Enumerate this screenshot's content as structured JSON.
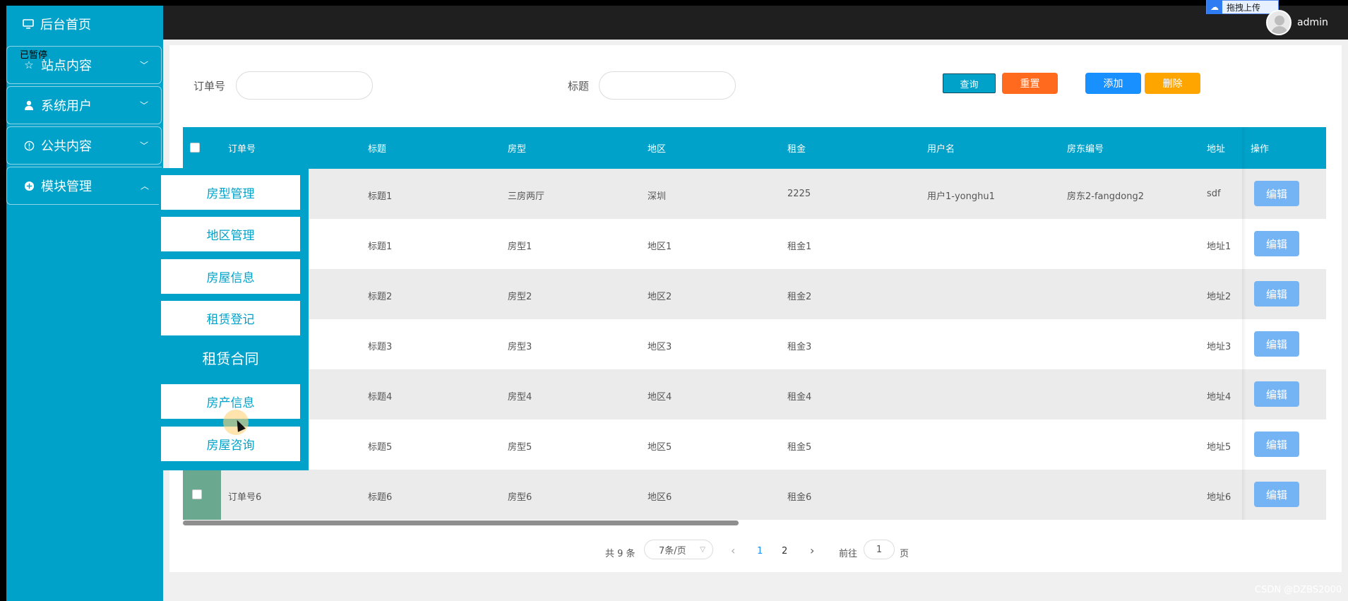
{
  "colors": {
    "primary": "#00a2c9",
    "reset": "#ff6a1e",
    "add": "#1890ff",
    "delete": "#ffa500",
    "edit": "#74b4f5"
  },
  "sidebar": {
    "home": {
      "label": "后台首页",
      "icon": "monitor-icon"
    },
    "paused_label": "已暂停",
    "items": [
      {
        "label": "站点内容",
        "icon": "star-icon"
      },
      {
        "label": "系统用户",
        "icon": "user-icon"
      },
      {
        "label": "公共内容",
        "icon": "info-circle-icon"
      },
      {
        "label": "模块管理",
        "icon": "plus-circle-icon"
      }
    ]
  },
  "topbar": {
    "username": "admin",
    "upload_label": "拖拽上传"
  },
  "search": {
    "order_label": "订单号",
    "title_label": "标题",
    "query_label": "查询",
    "reset_label": "重置",
    "add_label": "添加",
    "delete_label": "删除"
  },
  "table": {
    "headers": [
      "订单号",
      "标题",
      "房型",
      "地区",
      "租金",
      "用户名",
      "房东编号",
      "地址",
      "操作"
    ],
    "rows": [
      {
        "order": "",
        "title": "标题1",
        "type": "三房两厅",
        "region": "深圳",
        "rent": "2225",
        "user": "用户1-yonghu1",
        "landlord": "房东2-fangdong2",
        "address": "sdf"
      },
      {
        "order": "",
        "title": "标题1",
        "type": "房型1",
        "region": "地区1",
        "rent": "租金1",
        "user": "",
        "landlord": "",
        "address": "地址1"
      },
      {
        "order": "",
        "title": "标题2",
        "type": "房型2",
        "region": "地区2",
        "rent": "租金2",
        "user": "",
        "landlord": "",
        "address": "地址2"
      },
      {
        "order": "",
        "title": "标题3",
        "type": "房型3",
        "region": "地区3",
        "rent": "租金3",
        "user": "",
        "landlord": "",
        "address": "地址3"
      },
      {
        "order": "",
        "title": "标题4",
        "type": "房型4",
        "region": "地区4",
        "rent": "租金4",
        "user": "",
        "landlord": "",
        "address": "地址4"
      },
      {
        "order": "",
        "title": "标题5",
        "type": "房型5",
        "region": "地区5",
        "rent": "租金5",
        "user": "",
        "landlord": "",
        "address": "地址5"
      },
      {
        "order": "订单号6",
        "title": "标题6",
        "type": "房型6",
        "region": "地区6",
        "rent": "租金6",
        "user": "",
        "landlord": "",
        "address": "地址6"
      }
    ],
    "edit_label": "编辑"
  },
  "pagination": {
    "total": "共 9 条",
    "page_size": "7条/页",
    "prev": "‹",
    "next": "›",
    "pages": [
      "1",
      "2"
    ],
    "goto_prefix": "前往",
    "goto_value": "1",
    "goto_suffix": "页"
  },
  "flyout": {
    "items_top": [
      "房型管理",
      "地区管理",
      "房屋信息",
      "租赁登记"
    ],
    "title": "租赁合同",
    "items_bottom": [
      "房产信息",
      "房屋咨询"
    ]
  },
  "watermark": "CSDN @DZBS2000"
}
